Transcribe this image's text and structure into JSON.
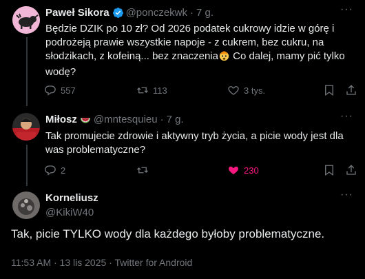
{
  "tweets": [
    {
      "name": "Paweł Sikora",
      "handle": "@ponczekwk",
      "time": "7 g.",
      "lines": [
        "Będzie DZIK po 10 zł? Od 2026 podatek cukrowy idzie w górę i",
        "podrożeją prawie wszystkie napoje - z cukrem, bez cukru, na",
        "słodzikach, z kofeiną... bez znaczenia",
        "wodę?"
      ],
      "line3_tail": " Co dalej, mamy pić tylko",
      "replies": "557",
      "retweets": "113",
      "likes": "3 tys.",
      "accent": "#1d9bf0"
    },
    {
      "name": "Miłosz",
      "handle": "@mntesquieu",
      "time": "7 g.",
      "lines": [
        "Tak promujecie zdrowie i aktywny tryb życia, a picie wody jest dla",
        "was problematyczne?"
      ],
      "replies": "2",
      "retweets": "",
      "likes": "230",
      "like_color": "#f91880"
    }
  ],
  "main": {
    "name": "Korneliusz",
    "handle": "@KikiW40",
    "text": "Tak, picie TYLKO wody dla każdego byłoby problematyczne.",
    "meta": "11:53 AM · 13 lis 2025 · Twitter for Android"
  },
  "icons": {
    "verified": "verified-badge-icon",
    "watermelon": "watermelon-emoji",
    "mindblown": "exploding-head-emoji"
  }
}
